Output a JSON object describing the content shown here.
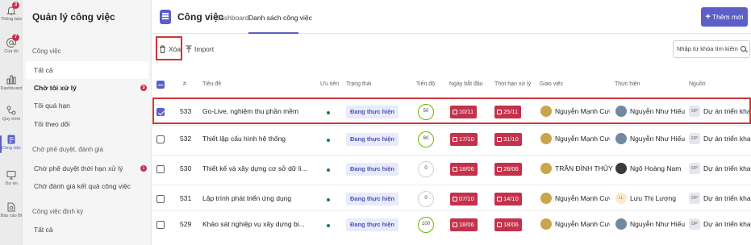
{
  "rail": [
    {
      "label": "Thông báo",
      "icon": "bell-icon",
      "badge": "3"
    },
    {
      "label": "Của tôi",
      "icon": "at-icon",
      "badge": "7"
    },
    {
      "label": "Dashboard",
      "icon": "bar-chart-icon",
      "badge": ""
    },
    {
      "label": "Quy trình",
      "icon": "flow-icon",
      "badge": ""
    },
    {
      "label": "Công việc",
      "icon": "tasks-icon",
      "badge": ""
    },
    {
      "label": "Dự án",
      "icon": "monitor-icon",
      "badge": ""
    },
    {
      "label": "Báo cáo BI",
      "icon": "report-icon",
      "badge": ""
    }
  ],
  "panel": {
    "title": "Quản lý công việc",
    "sections": [
      {
        "title": "Công việc",
        "items": [
          {
            "label": "Tất cả",
            "badge": ""
          },
          {
            "label": "Chờ tôi xử lý",
            "badge": "3"
          },
          {
            "label": "Tôi quá hạn",
            "badge": ""
          },
          {
            "label": "Tôi theo dõi",
            "badge": ""
          }
        ]
      },
      {
        "title": "Chờ phê duyệt, đánh giá",
        "items": [
          {
            "label": "Chờ phê duyệt thời hạn xử lý",
            "badge": "1"
          },
          {
            "label": "Chờ đánh giá kết quả công việc",
            "badge": ""
          }
        ]
      },
      {
        "title": "Công việc định kỳ",
        "items": [
          {
            "label": "Tất cả",
            "badge": ""
          }
        ]
      }
    ]
  },
  "header": {
    "title": "Công việc",
    "tabs": [
      "Dashboard",
      "Danh sách công việc"
    ],
    "new_button": "Thêm mới"
  },
  "toolbar": {
    "delete": "Xóa",
    "import": "Import",
    "search_placeholder": "Nhập từ khóa tìm kiếm"
  },
  "table": {
    "columns": [
      "#",
      "Tiêu đề",
      "Ưu tiên",
      "Trạng thái",
      "Tiến độ",
      "Ngày bắt đầu",
      "Thời hạn xử lý",
      "Giao việc",
      "Thực hiện",
      "Nguồn"
    ],
    "rows": [
      {
        "checked": true,
        "id": "533",
        "title": "Go-Live, nghiệm thu phần mềm",
        "status": "Đang thực hiện",
        "progress": "50",
        "start": "10/11",
        "due": "25/11",
        "assigner": "Nguyễn Mạnh Cường",
        "assignee": "Nguyễn Như Hiếu",
        "source_initials": "DP",
        "source": "Dự án triển khai phần mềm"
      },
      {
        "checked": false,
        "id": "532",
        "title": "Thiết lập cấu hình hệ thống",
        "status": "Đang thực hiện",
        "progress": "60",
        "start": "17/10",
        "due": "31/10",
        "assigner": "Nguyễn Mạnh Cường",
        "assignee": "Nguyễn Như Hiếu",
        "source_initials": "DP",
        "source": "Dự án triển khai phần mềm"
      },
      {
        "checked": false,
        "id": "530",
        "title": "Thiết kế và xây dựng cơ sở dữ li...",
        "status": "Đang thực hiện",
        "progress": "0",
        "start": "18/06",
        "due": "28/06",
        "assigner": "TRẦN ĐÌNH THỦY",
        "assignee": "Ngô Hoàng Nam",
        "source_initials": "DP",
        "source": "Dự án triển khai phần mềm"
      },
      {
        "checked": false,
        "id": "531",
        "title": "Lập trình phát triển ứng dụng",
        "status": "Đang thực hiện",
        "progress": "0",
        "start": "07/10",
        "due": "14/10",
        "assigner": "Nguyễn Mạnh Cường",
        "assignee": "Lưu Thị Lương",
        "assignee_initials": "LL",
        "source_initials": "DP",
        "source": "Dự án triển khai phần mềm"
      },
      {
        "checked": false,
        "id": "529",
        "title": "Khảo sát nghiệp vụ xây dựng bi...",
        "status": "Đang thực hiện",
        "progress": "100",
        "start": "18/06",
        "due": "18/06",
        "assigner": "Nguyễn Mạnh Cường",
        "assignee": "Nguyễn Như Hiếu",
        "source_initials": "DP",
        "source": "Dự án triển khai phần mềm"
      }
    ]
  },
  "colors": {
    "accent": "#5b5fc7",
    "danger": "#c4314b",
    "highlight": "#d13438"
  }
}
